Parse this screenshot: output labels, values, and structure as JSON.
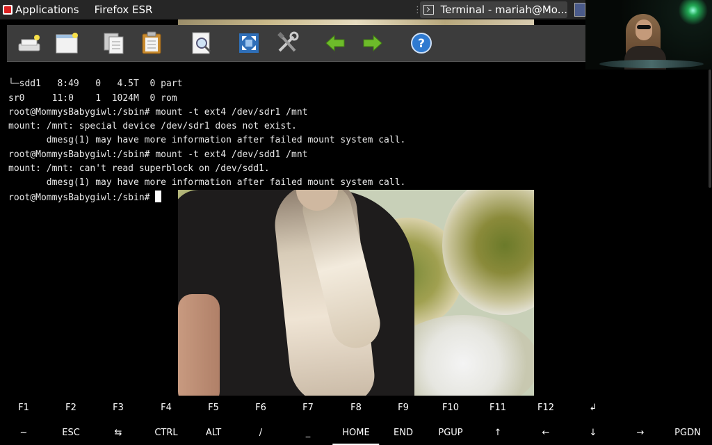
{
  "panel": {
    "applications": "Applications",
    "firefox": "Firefox ESR",
    "separator": "⋮",
    "terminal_task": "Terminal - mariah@Mo..."
  },
  "toolbar": {
    "buttons": [
      {
        "name": "new-connection-icon"
      },
      {
        "name": "new-window-icon"
      },
      {
        "name": "copy-icon"
      },
      {
        "name": "paste-icon"
      },
      {
        "name": "find-icon"
      },
      {
        "name": "fullscreen-icon"
      },
      {
        "name": "preferences-icon"
      },
      {
        "name": "back-icon"
      },
      {
        "name": "forward-icon"
      },
      {
        "name": "help-icon"
      }
    ]
  },
  "terminal": {
    "lines": [
      "└─sdd1   8:49   0   4.5T  0 part",
      "sr0     11:0    1  1024M  0 rom",
      "root@MommysBabygiwl:/sbin# mount -t ext4 /dev/sdr1 /mnt",
      "mount: /mnt: special device /dev/sdr1 does not exist.",
      "       dmesg(1) may have more information after failed mount system call.",
      "root@MommysBabygiwl:/sbin# mount -t ext4 /dev/sdd1 /mnt",
      "mount: /mnt: can't read superblock on /dev/sdd1.",
      "       dmesg(1) may have more information after failed mount system call."
    ],
    "prompt": "root@MommysBabygiwl:/sbin# "
  },
  "keyboard": {
    "row1": [
      "F1",
      "F2",
      "F3",
      "F4",
      "F5",
      "F6",
      "F7",
      "F8",
      "F9",
      "F10",
      "F11",
      "F12",
      "↲"
    ],
    "row2": [
      "~",
      "ESC",
      "⇆",
      "CTRL",
      "ALT",
      "/",
      "_",
      "HOME",
      "END",
      "PGUP",
      "↑",
      "←",
      "↓",
      "→",
      "PGDN"
    ],
    "active_key": "HOME"
  },
  "colors": {
    "panel_bg": "#262626",
    "toolbar_bg": "#3c3c3c",
    "terminal_bg": "#000000",
    "terminal_fg": "#e8e8e8"
  }
}
